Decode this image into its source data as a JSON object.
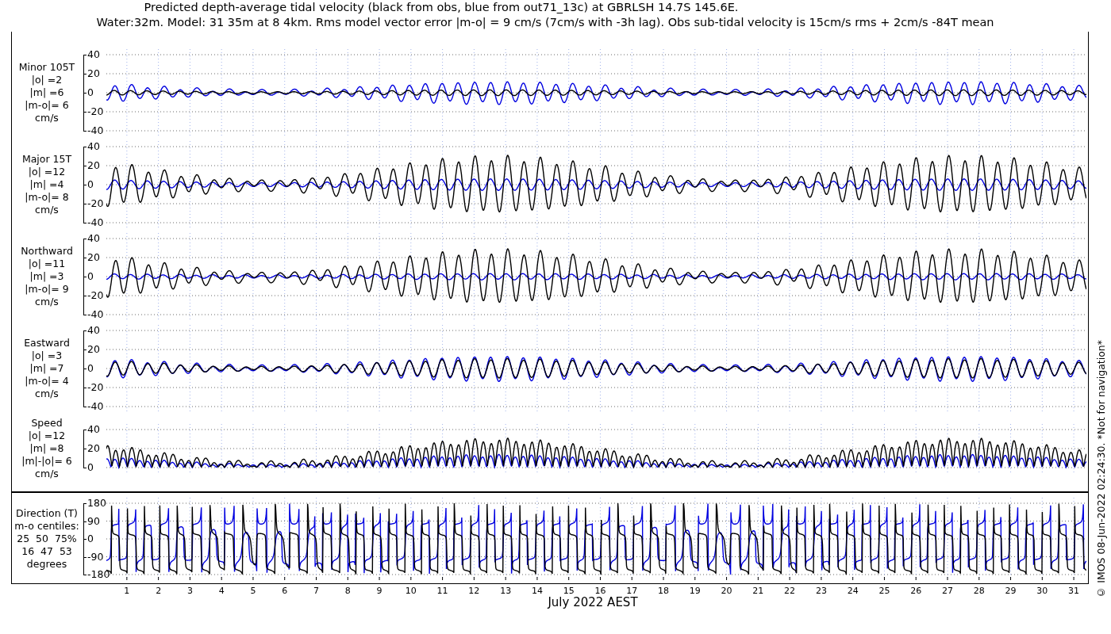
{
  "title": [
    "Predicted depth-average tidal velocity (black from obs, blue from out71_13c) at GBRLSH 14.7S 145.6E.",
    "Water:32m. Model: 31 35m at 8 4km. Rms model vector error |m-o| = 9 cm/s (7cm/s with -3h lag). Obs sub-tidal velocity is 15cm/s rms + 2cm/s -84T mean"
  ],
  "panels": [
    {
      "kind": "minor",
      "label": [
        "Minor 105T",
        "|o| =2",
        "|m| =6",
        "|m-o|= 6",
        "cm/s"
      ],
      "tick_labels": [
        "40",
        "20",
        "0",
        "-20",
        "-40"
      ]
    },
    {
      "kind": "major",
      "label": [
        "Major 15T",
        "|o| =12",
        "|m| =4",
        "|m-o|= 8",
        "cm/s"
      ],
      "tick_labels": [
        "40",
        "20",
        "0",
        "-20",
        "-40"
      ]
    },
    {
      "kind": "north",
      "label": [
        "Northward",
        "|o| =11",
        "|m| =3",
        "|m-o|= 9",
        "cm/s"
      ],
      "tick_labels": [
        "40",
        "20",
        "0",
        "-20",
        "-40"
      ]
    },
    {
      "kind": "east",
      "label": [
        "Eastward",
        "|o| =3",
        "|m| =7",
        "|m-o|= 4",
        "cm/s"
      ],
      "tick_labels": [
        "40",
        "20",
        "0",
        "-20",
        "-40"
      ]
    },
    {
      "kind": "speed",
      "label": [
        "Speed",
        "|o| =12",
        "|m| =8",
        "|m|-|o|= 6",
        "cm/s"
      ],
      "tick_labels": [
        "40",
        "20",
        "0"
      ]
    },
    {
      "kind": "direction",
      "label": [
        "Direction (T)",
        "m-o centiles:",
        "25  50  75%",
        "16  47  53",
        "degrees"
      ],
      "tick_labels": [
        "180",
        "90",
        "0",
        "-90",
        "-180"
      ]
    }
  ],
  "x_axis": {
    "day_labels": [
      "1",
      "2",
      "3",
      "4",
      "5",
      "6",
      "7",
      "8",
      "9",
      "10",
      "11",
      "12",
      "13",
      "14",
      "15",
      "16",
      "17",
      "18",
      "19",
      "20",
      "21",
      "22",
      "23",
      "24",
      "25",
      "26",
      "27",
      "28",
      "29",
      "30",
      "31"
    ],
    "label": "July 2022 AEST"
  },
  "credit": "© IMOS 08-Jun-2022 02:24:30. *Not for navigation*"
}
